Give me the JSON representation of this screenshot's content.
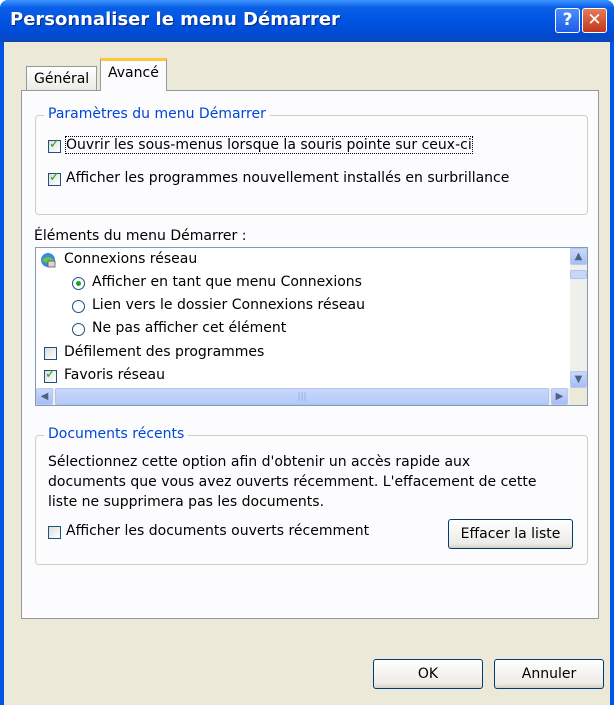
{
  "window": {
    "title": "Personnaliser le menu Démarrer",
    "help_glyph": "?",
    "close_glyph": "✕"
  },
  "tabs": [
    {
      "label": "Général",
      "active": false
    },
    {
      "label": "Avancé",
      "active": true
    }
  ],
  "start_settings": {
    "legend": "Paramètres du menu Démarrer",
    "options": [
      {
        "label": "Ouvrir les sous-menus lorsque la souris pointe sur ceux-ci",
        "checked": true
      },
      {
        "label": "Afficher les programmes nouvellement installés en surbrillance",
        "checked": true
      }
    ]
  },
  "items": {
    "label": "Éléments du menu Démarrer :",
    "rows": [
      {
        "label": "Connexions réseau",
        "kind": "group",
        "icon": "network-connections-icon"
      },
      {
        "label": "Afficher en tant que menu Connexions",
        "kind": "radio",
        "selected": true
      },
      {
        "label": "Lien vers le dossier Connexions réseau",
        "kind": "radio",
        "selected": false
      },
      {
        "label": "Ne pas afficher cet élément",
        "kind": "radio",
        "selected": false
      },
      {
        "label": "Défilement des programmes",
        "kind": "checkbox",
        "checked": false
      },
      {
        "label": "Favoris réseau",
        "kind": "checkbox",
        "checked": true
      }
    ]
  },
  "recent_docs": {
    "legend": "Documents récents",
    "description": [
      "Sélectionnez cette option afin d'obtenir un accès rapide aux",
      "documents que vous avez ouverts récemment. L'effacement de cette",
      "liste ne supprimera pas les documents."
    ],
    "show_label": "Afficher les documents ouverts récemment",
    "show_checked": false,
    "clear_label": "Effacer la liste"
  },
  "footer": {
    "ok": "OK",
    "cancel": "Annuler"
  },
  "colors": {
    "title_bar": "#0054e3",
    "group_legend": "#0046d5",
    "check": "#21a121"
  }
}
